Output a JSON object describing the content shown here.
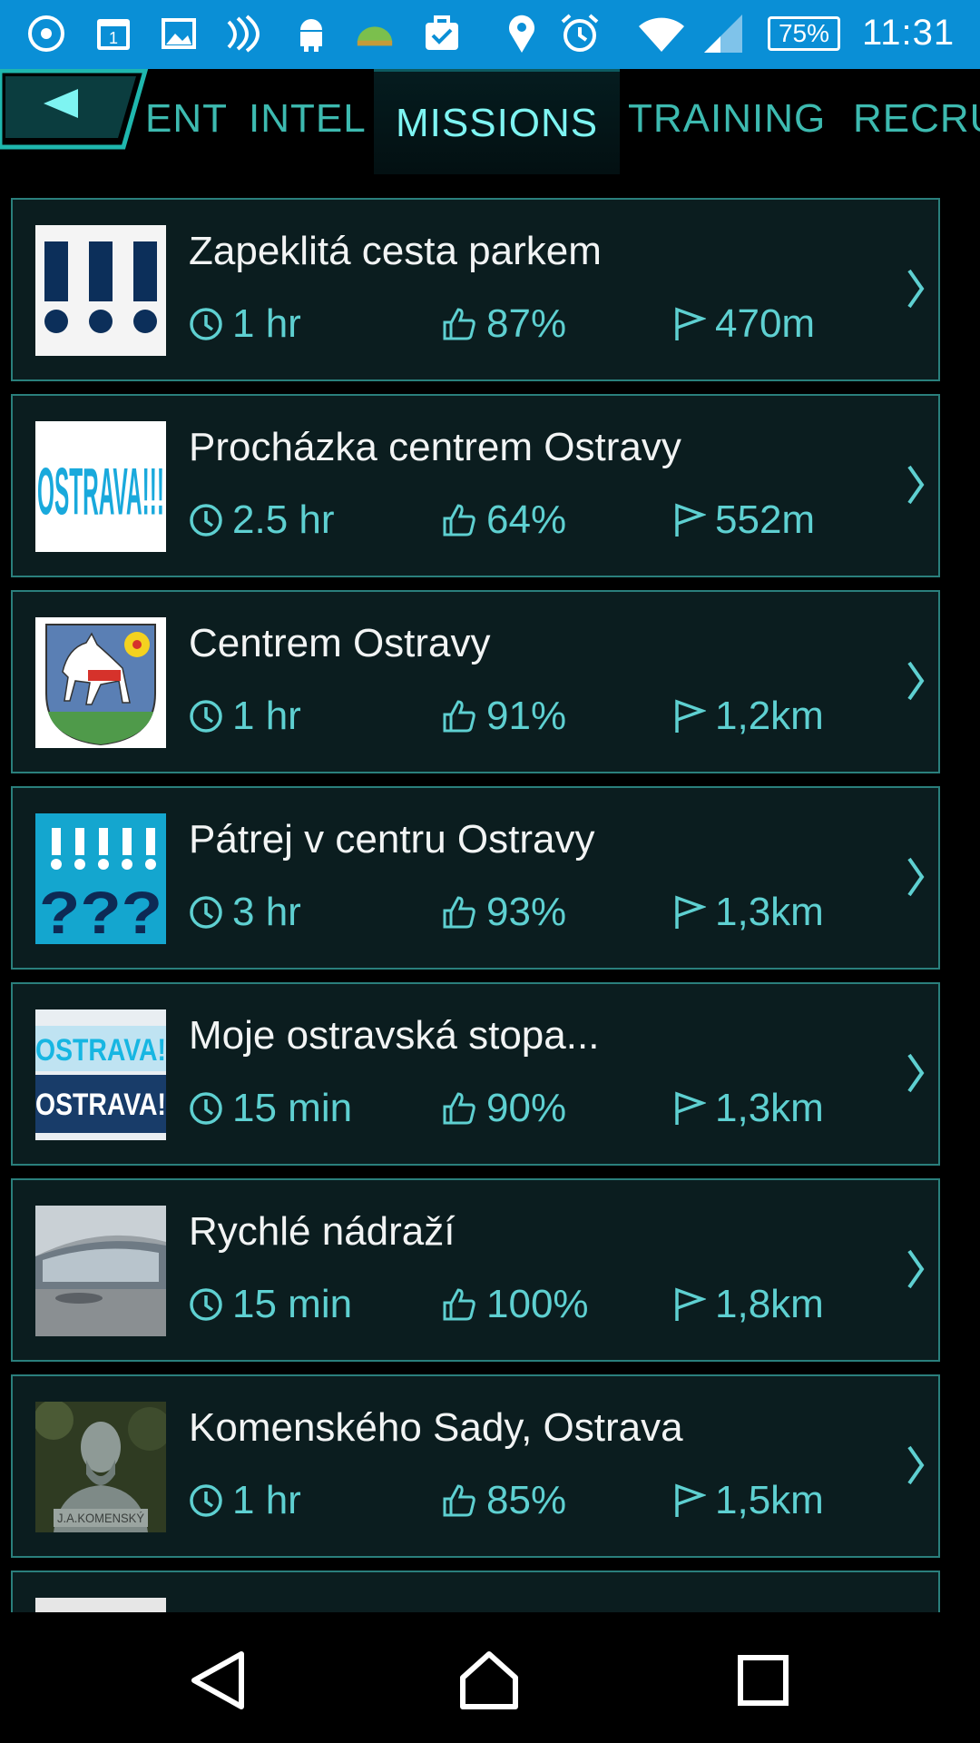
{
  "status_bar": {
    "battery": "75%",
    "time": "11:31",
    "icons": [
      "chat-icon",
      "calendar-icon",
      "image-icon",
      "nfc-icon",
      "android-icon",
      "weather-icon",
      "task-icon",
      "location-icon",
      "alarm-icon",
      "wifi-icon",
      "signal-icon"
    ],
    "calendar_day": "1"
  },
  "tabs": [
    {
      "label": "ENT"
    },
    {
      "label": "INTEL"
    },
    {
      "label": "MISSIONS"
    },
    {
      "label": "TRAINING"
    },
    {
      "label": "RECRU"
    }
  ],
  "active_tab": "MISSIONS",
  "missions": [
    {
      "title": "Zapeklitá cesta parkem",
      "time": "1 hr",
      "rating": "87%",
      "distance": "470m"
    },
    {
      "title": "Procházka centrem Ostravy",
      "time": "2.5 hr",
      "rating": "64%",
      "distance": "552m",
      "thumb_text": "OSTRAVA!!!"
    },
    {
      "title": "Centrem Ostravy",
      "time": "1 hr",
      "rating": "91%",
      "distance": "1,2km"
    },
    {
      "title": "Pátrej v centru Ostravy",
      "time": "3 hr",
      "rating": "93%",
      "distance": "1,3km",
      "thumb_text": "???"
    },
    {
      "title": "Moje ostravská stopa...",
      "time": "15 min",
      "rating": "90%",
      "distance": "1,3km",
      "thumb_text": "OSTRAVA!"
    },
    {
      "title": "Rychlé nádraží",
      "time": "15 min",
      "rating": "100%",
      "distance": "1,8km"
    },
    {
      "title": "Komenského Sady, Ostrava",
      "time": "1 hr",
      "rating": "85%",
      "distance": "1,5km",
      "thumb_text": "J.A.KOMENSKÝ"
    }
  ],
  "colors": {
    "status_bar": "#0a8fd6",
    "accent": "#7ef4f2",
    "tab_text": "#3dbab0",
    "card_bg": "#0b1d1f",
    "card_border": "#2a7f7c",
    "meta_text": "#5ed0d1"
  }
}
